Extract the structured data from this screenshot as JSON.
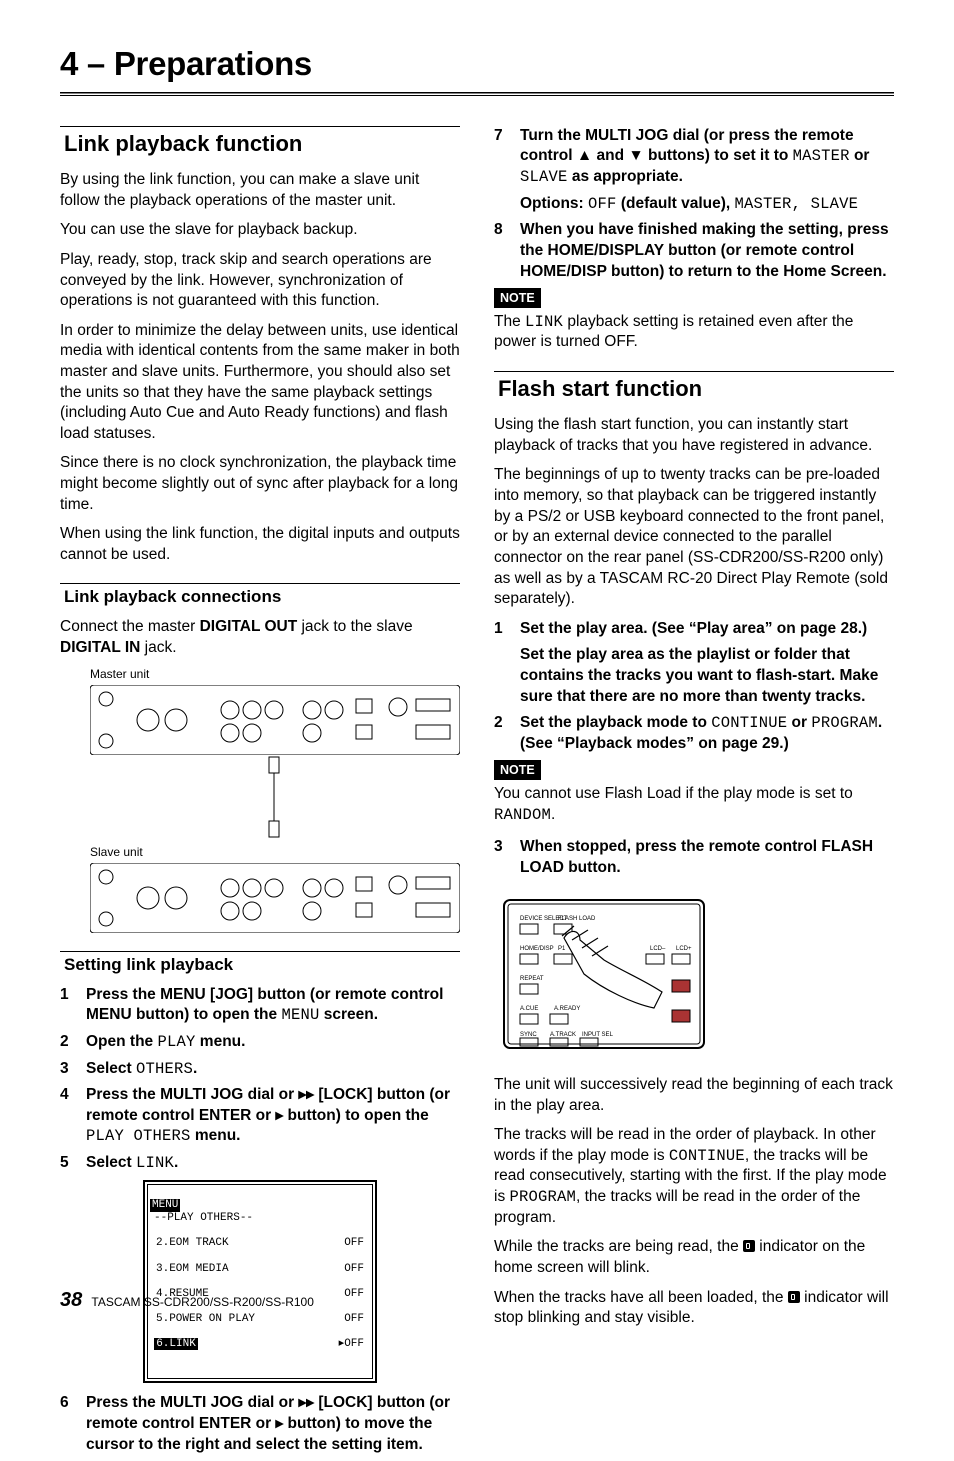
{
  "chapter": "4 – Preparations",
  "left": {
    "h2": "Link playback function",
    "p1": "By using the link function, you can make a slave unit follow the playback operations of the master unit.",
    "p2": "You can use the slave for playback backup.",
    "p3": "Play, ready, stop, track skip and search operations are conveyed by the link. However, synchronization of operations is not guaranteed with this function.",
    "p4": "In order to minimize the delay between units, use identical media with identical contents from the same maker in both master and slave units. Furthermore, you should also set the units so that they have the same playback settings (including Auto Cue and Auto Ready functions) and flash load statuses.",
    "p5": "Since there is no clock synchronization, the playback time might become slightly out of sync after playback for a long time.",
    "p6": "When using the link function, the digital inputs and outputs cannot be used.",
    "sub1": "Link playback connections",
    "sub1_body_a": "Connect the master ",
    "sub1_body_b": "DIGITAL OUT",
    "sub1_body_c": " jack to the slave ",
    "sub1_body_d": "DIGITAL IN",
    "sub1_body_e": " jack.",
    "cap_master": "Master unit",
    "cap_slave": "Slave unit",
    "sub2": "Setting link playback",
    "steps": {
      "s1a": "Press the MENU [JOG] button (or remote control MENU button) to open the ",
      "s1b": "MENU",
      "s1c": " screen.",
      "s2a": "Open the ",
      "s2b": "PLAY",
      "s2c": " menu.",
      "s3a": "Select ",
      "s3b": "OTHERS",
      "s3c": ".",
      "s4a": "Press the MULTI JOG dial or ▸▸ [LOCK] button (or remote control ENTER or ▸ button) to open the ",
      "s4b": "PLAY OTHERS",
      "s4c": " menu.",
      "s5a": "Select ",
      "s5b": "LINK",
      "s5c": ".",
      "s6": "Press the MULTI JOG dial or ▸▸ [LOCK] button (or remote control ENTER or ▸ button) to move the cursor to the right and select the setting item."
    },
    "menu": {
      "title": "MENU",
      "sub": "--PLAY OTHERS--",
      "rows": [
        {
          "l": "2.EOM TRACK",
          "r": "OFF"
        },
        {
          "l": "3.EOM MEDIA",
          "r": "OFF"
        },
        {
          "l": "4.RESUME",
          "r": "OFF"
        },
        {
          "l": "5.POWER ON PLAY",
          "r": "OFF"
        },
        {
          "l": "6.LINK",
          "r": "▸OFF",
          "sel": true
        }
      ]
    }
  },
  "right": {
    "s7a": "Turn the MULTI JOG dial (or press the remote control ▲ and ▼ buttons) to set it to ",
    "s7b": "MASTER",
    "s7c": " or ",
    "s7d": "SLAVE",
    "s7e": " as appropriate.",
    "s7_opt_a": "Options: ",
    "s7_opt_b": "OFF",
    "s7_opt_c": " (default value), ",
    "s7_opt_d": "MASTER",
    "s7_opt_e": ", ",
    "s7_opt_f": "SLAVE",
    "s8": "When you have finished making the setting, press the HOME/DISPLAY button (or remote control HOME/DISP button) to return to the Home Screen.",
    "note1_label": "NOTE",
    "note1_a": "The ",
    "note1_b": "LINK",
    "note1_c": " playback setting is retained even after the power is turned OFF.",
    "h2b": "Flash start function",
    "fp1": "Using the flash start function, you can instantly start playback of tracks that you have registered in advance.",
    "fp2": "The beginnings of up to twenty tracks can be pre-loaded into memory, so that playback can be triggered instantly by a PS/2 or USB keyboard connected to the front panel, or by an external device connected to the parallel connector on the rear panel (SS-CDR200/SS-R200 only) as well as by a TASCAM RC-20 Direct Play Remote (sold separately).",
    "fs1_a": "Set the play area. (See “Play area” on page 28.)",
    "fs1_b": "Set the play area as the playlist or folder that contains the tracks you want to flash-start. Make sure that there are no more than twenty tracks.",
    "fs2_a": "Set the playback mode to ",
    "fs2_b": "CONTINUE",
    "fs2_c": " or ",
    "fs2_d": "PROGRAM",
    "fs2_e": ". (See “Playback modes” on page 29.)",
    "note2_label": "NOTE",
    "note2_a": "You cannot use Flash Load if the play mode is set to ",
    "note2_b": "RANDOM",
    "note2_c": ".",
    "fs3": "When stopped, press the remote control FLASH LOAD button.",
    "remote_labels": {
      "device": "DEVICE SELECT",
      "flash": "FLASH LOAD",
      "home": "HOME/DISP",
      "p1": "P1",
      "lcdm": "LCD–",
      "lcdp": "LCD+",
      "repeat": "REPEAT",
      "acue": "A.CUE",
      "aready": "A.READY",
      "sync": "SYNC",
      "atrack": "A.TRACK",
      "input": "INPUT SEL"
    },
    "fp3": "The unit will successively read the beginning of each track in the play area.",
    "fp4_a": "The tracks will be read in the order of playback. In other words if the play mode is ",
    "fp4_b": "CONTINUE",
    "fp4_c": ", the tracks will be read consecutively, starting with the first. If the play mode is ",
    "fp4_d": "PROGRAM",
    "fp4_e": ", the tracks will be read in the order of the program.",
    "fp5_a": "While the tracks are being read, the ",
    "fp5_b": " indicator on the home screen will blink.",
    "fp6_a": "When the tracks have all been loaded, the ",
    "fp6_b": " indicator will stop blinking and stay visible."
  },
  "footer": {
    "page": "38",
    "model": "TASCAM SS-CDR200/SS-R200/SS-R100"
  }
}
